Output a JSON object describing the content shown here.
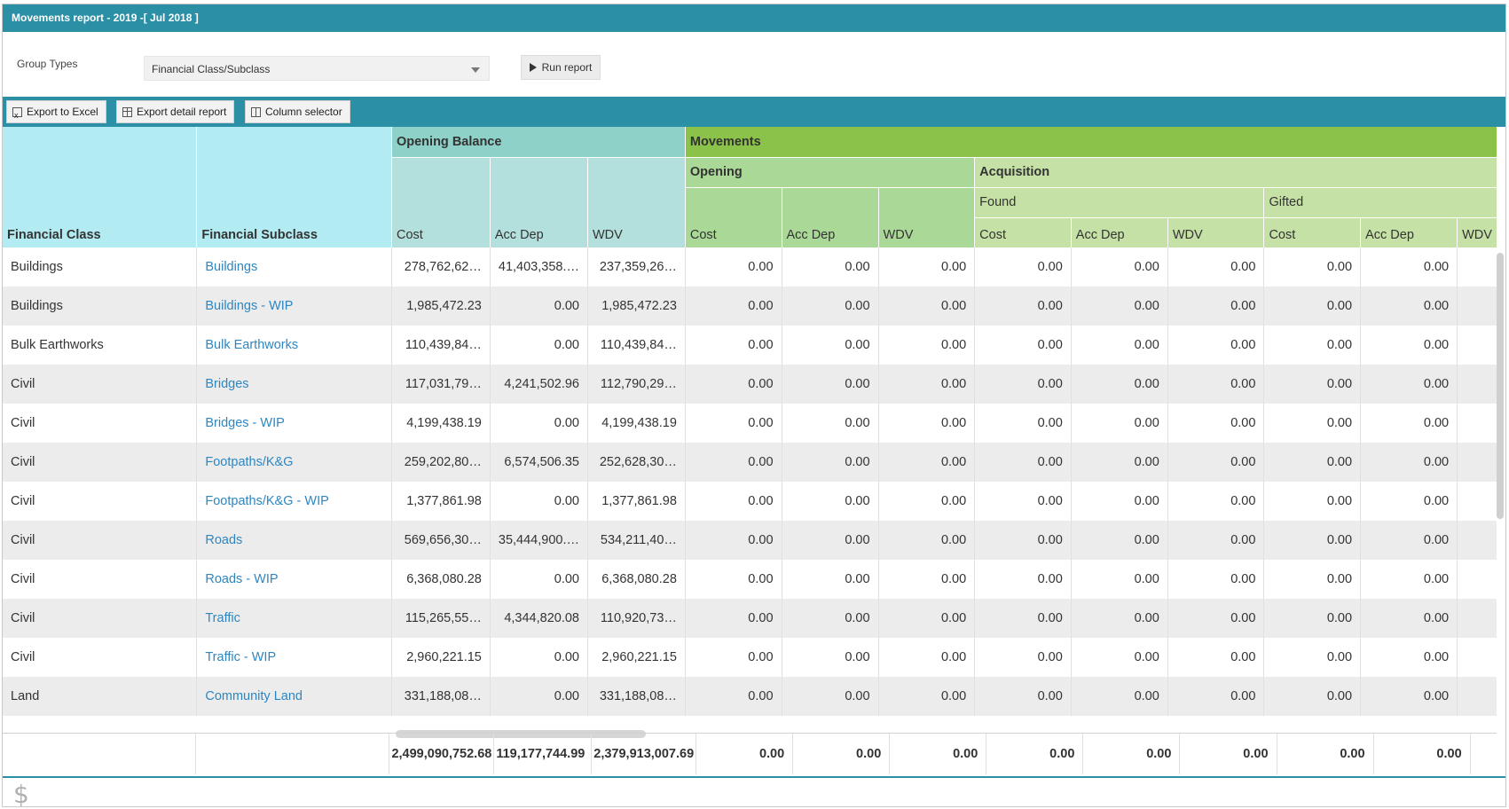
{
  "window": {
    "title": "Movements report - 2019 -[ Jul 2018 ]"
  },
  "params": {
    "group_types_label": "Group Types",
    "group_types_value": "Financial Class/Subclass",
    "run_label": "Run report"
  },
  "toolbar": {
    "export_excel": "Export to Excel",
    "export_detail": "Export detail report",
    "column_selector": "Column selector"
  },
  "header": {
    "financial_class": "Financial Class",
    "financial_subclass": "Financial Subclass",
    "opening_balance": "Opening Balance",
    "movements": "Movements",
    "opening": "Opening",
    "acquisition": "Acquisition",
    "found": "Found",
    "gifted": "Gifted",
    "cost": "Cost",
    "acc_dep": "Acc Dep",
    "wdv": "WDV"
  },
  "rows": [
    {
      "cls": "Buildings",
      "sub": "Buildings",
      "cost": "278,762,62…",
      "accdep": "41,403,358.…",
      "wdv": "237,359,26…",
      "m": [
        "0.00",
        "0.00",
        "0.00",
        "0.00",
        "0.00",
        "0.00",
        "0.00",
        "0.00"
      ]
    },
    {
      "cls": "Buildings",
      "sub": "Buildings - WIP",
      "cost": "1,985,472.23",
      "accdep": "0.00",
      "wdv": "1,985,472.23",
      "m": [
        "0.00",
        "0.00",
        "0.00",
        "0.00",
        "0.00",
        "0.00",
        "0.00",
        "0.00"
      ]
    },
    {
      "cls": "Bulk Earthworks",
      "sub": "Bulk Earthworks",
      "cost": "110,439,84…",
      "accdep": "0.00",
      "wdv": "110,439,84…",
      "m": [
        "0.00",
        "0.00",
        "0.00",
        "0.00",
        "0.00",
        "0.00",
        "0.00",
        "0.00"
      ]
    },
    {
      "cls": "Civil",
      "sub": "Bridges",
      "cost": "117,031,79…",
      "accdep": "4,241,502.96",
      "wdv": "112,790,29…",
      "m": [
        "0.00",
        "0.00",
        "0.00",
        "0.00",
        "0.00",
        "0.00",
        "0.00",
        "0.00"
      ]
    },
    {
      "cls": "Civil",
      "sub": "Bridges - WIP",
      "cost": "4,199,438.19",
      "accdep": "0.00",
      "wdv": "4,199,438.19",
      "m": [
        "0.00",
        "0.00",
        "0.00",
        "0.00",
        "0.00",
        "0.00",
        "0.00",
        "0.00"
      ]
    },
    {
      "cls": "Civil",
      "sub": "Footpaths/K&G",
      "cost": "259,202,80…",
      "accdep": "6,574,506.35",
      "wdv": "252,628,30…",
      "m": [
        "0.00",
        "0.00",
        "0.00",
        "0.00",
        "0.00",
        "0.00",
        "0.00",
        "0.00"
      ]
    },
    {
      "cls": "Civil",
      "sub": "Footpaths/K&G - WIP",
      "cost": "1,377,861.98",
      "accdep": "0.00",
      "wdv": "1,377,861.98",
      "m": [
        "0.00",
        "0.00",
        "0.00",
        "0.00",
        "0.00",
        "0.00",
        "0.00",
        "0.00"
      ]
    },
    {
      "cls": "Civil",
      "sub": "Roads",
      "cost": "569,656,30…",
      "accdep": "35,444,900.…",
      "wdv": "534,211,40…",
      "m": [
        "0.00",
        "0.00",
        "0.00",
        "0.00",
        "0.00",
        "0.00",
        "0.00",
        "0.00"
      ]
    },
    {
      "cls": "Civil",
      "sub": "Roads - WIP",
      "cost": "6,368,080.28",
      "accdep": "0.00",
      "wdv": "6,368,080.28",
      "m": [
        "0.00",
        "0.00",
        "0.00",
        "0.00",
        "0.00",
        "0.00",
        "0.00",
        "0.00"
      ]
    },
    {
      "cls": "Civil",
      "sub": "Traffic",
      "cost": "115,265,55…",
      "accdep": "4,344,820.08",
      "wdv": "110,920,73…",
      "m": [
        "0.00",
        "0.00",
        "0.00",
        "0.00",
        "0.00",
        "0.00",
        "0.00",
        "0.00"
      ]
    },
    {
      "cls": "Civil",
      "sub": "Traffic - WIP",
      "cost": "2,960,221.15",
      "accdep": "0.00",
      "wdv": "2,960,221.15",
      "m": [
        "0.00",
        "0.00",
        "0.00",
        "0.00",
        "0.00",
        "0.00",
        "0.00",
        "0.00"
      ]
    },
    {
      "cls": "Land",
      "sub": "Community Land",
      "cost": "331,188,08…",
      "accdep": "0.00",
      "wdv": "331,188,08…",
      "m": [
        "0.00",
        "0.00",
        "0.00",
        "0.00",
        "0.00",
        "0.00",
        "0.00",
        "0.00"
      ]
    }
  ],
  "totals": {
    "cost": "2,499,090,752.68",
    "accdep": "119,177,744.99",
    "wdv": "2,379,913,007.69",
    "m": [
      "0.00",
      "0.00",
      "0.00",
      "0.00",
      "0.00",
      "0.00",
      "0.00",
      "0.00"
    ]
  },
  "footer": {
    "currency_icon": "dollar-icon"
  }
}
